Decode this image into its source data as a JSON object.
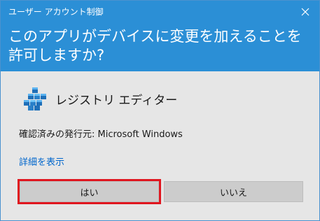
{
  "window": {
    "title": "ユーザー アカウント制御",
    "question": "このアプリがデバイスに変更を加えることを許可しますか?"
  },
  "app": {
    "name": "レジストリ エディター",
    "icon": "registry-editor-icon"
  },
  "publisher": {
    "label": "確認済みの発行元: Microsoft Windows"
  },
  "details": {
    "link_text": "詳細を表示"
  },
  "buttons": {
    "yes": "はい",
    "no": "いいえ"
  },
  "colors": {
    "header_bg": "#2b8fd6",
    "body_bg": "#e6e6e6",
    "highlight": "#e0161f",
    "link": "#0066cc"
  }
}
